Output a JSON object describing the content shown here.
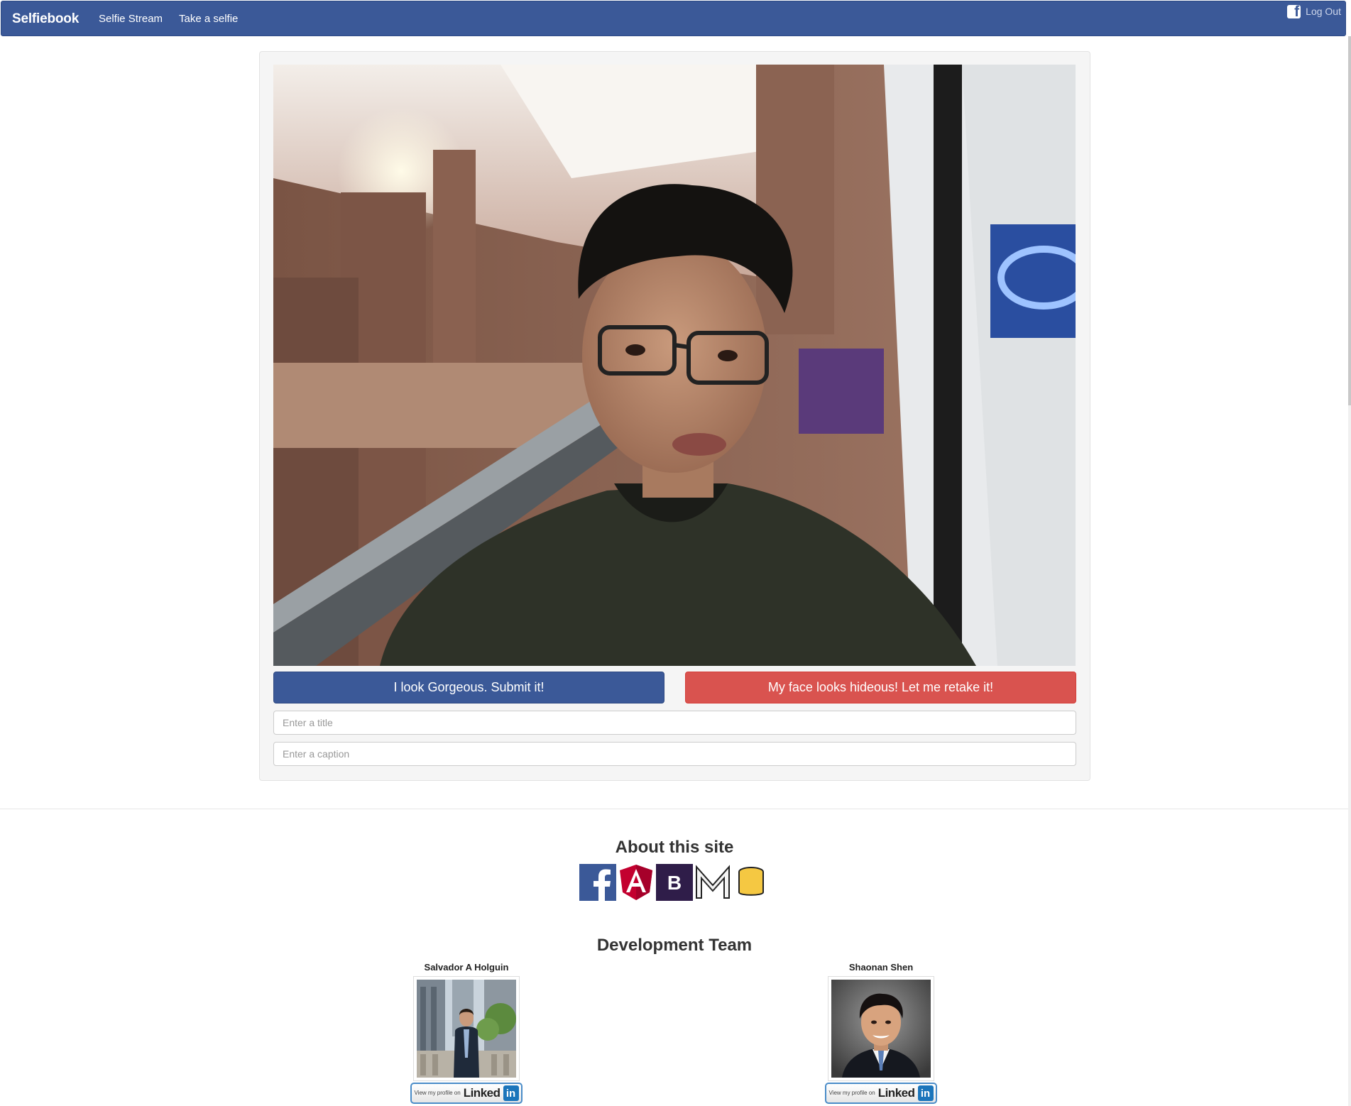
{
  "navbar": {
    "brand": "Selfiebook",
    "links": [
      "Selfie Stream",
      "Take a selfie"
    ],
    "logout": "Log Out"
  },
  "capture": {
    "submit_label": "I look Gorgeous. Submit it!",
    "retake_label": "My face looks hideous! Let me retake it!",
    "title_placeholder": "Enter a title",
    "caption_placeholder": "Enter a caption"
  },
  "about": {
    "heading": "About this site",
    "logos": [
      "facebook-logo",
      "angular-logo",
      "bootstrap-logo",
      "mean-logo",
      "database-logo"
    ]
  },
  "team": {
    "heading": "Development Team",
    "members": [
      {
        "name": "Salvador A Holguin",
        "badge_small": "View my profile on",
        "badge_text": "Linked",
        "badge_in": "in"
      },
      {
        "name": "Shaonan Shen",
        "badge_small": "View my profile on",
        "badge_text": "Linked",
        "badge_in": "in"
      }
    ]
  },
  "colors": {
    "navbar": "#3b5998",
    "submit": "#3b5998",
    "retake": "#d9534f",
    "linkedin": "#1b75bb"
  }
}
